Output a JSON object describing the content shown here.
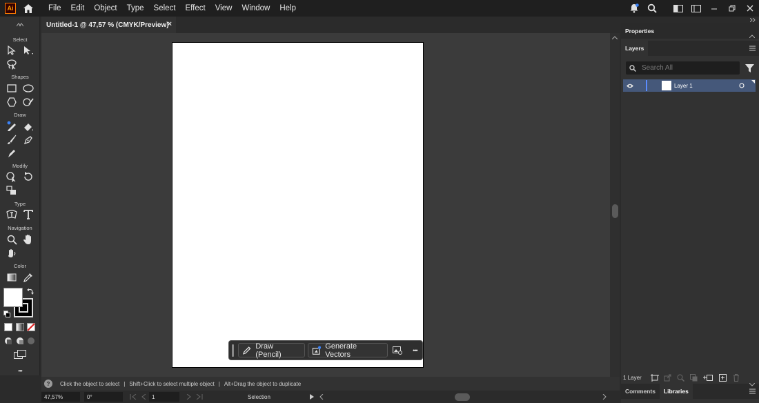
{
  "app": {
    "logo_text": "Ai"
  },
  "menu": {
    "items": [
      "File",
      "Edit",
      "Object",
      "Type",
      "Select",
      "Effect",
      "View",
      "Window",
      "Help"
    ]
  },
  "document": {
    "tab_title": "Untitled-1 @ 47,57 % (CMYK/Preview)",
    "close_glyph": "×"
  },
  "toolbar": {
    "sections": {
      "select": "Select",
      "shapes": "Shapes",
      "draw": "Draw",
      "modify": "Modify",
      "type": "Type",
      "navigation": "Navigation",
      "color": "Color"
    },
    "more_glyph": "•••"
  },
  "context_bar": {
    "draw_label": "Draw (Pencil)",
    "generate_label": "Generate Vectors",
    "more_glyph": "•••"
  },
  "status_hint": {
    "hint1": "Click the object to select",
    "hint2": "Shift+Click to select multiple object",
    "hint3": "Alt+Drag the object to duplicate",
    "separator": "|",
    "help_glyph": "?"
  },
  "statusbar": {
    "zoom": "47,57%",
    "rotation": "0°",
    "artboard": "1",
    "tool": "Selection"
  },
  "panel": {
    "properties_tab": "Properties",
    "layers_tab": "Layers",
    "search_placeholder": "Search All",
    "layer_name": "Layer 1",
    "layer_count": "1 Layer",
    "comments_tab": "Comments",
    "libraries_tab": "Libraries"
  },
  "colors": {
    "accent": "#45587a",
    "canvas": "#3b3b3b",
    "panel": "#323232",
    "logo": "#ff9a00"
  }
}
